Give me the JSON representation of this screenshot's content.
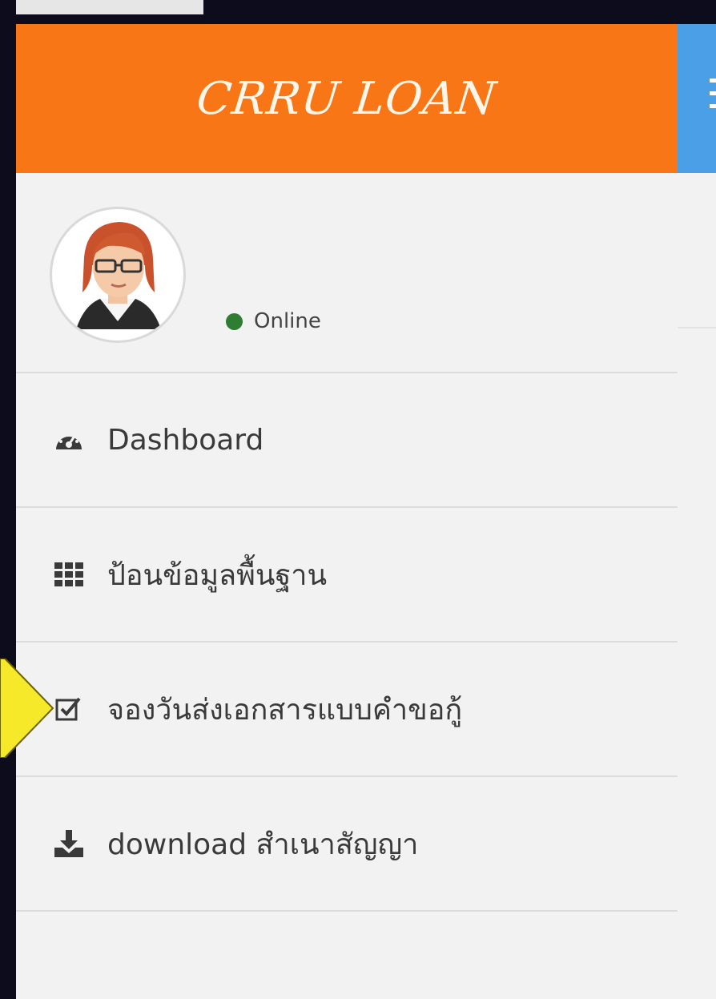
{
  "brand": {
    "title": "CRRU LOAN"
  },
  "user": {
    "status_text": "Online",
    "status_color": "#2e7d32"
  },
  "menu": {
    "items": [
      {
        "label": "Dashboard",
        "icon": "dashboard-icon"
      },
      {
        "label": "ป้อนข้อมูลพื้นฐาน",
        "icon": "grid-icon"
      },
      {
        "label": "จองวันส่งเอกสารแบบคำขอกู้",
        "icon": "checkbox-icon"
      },
      {
        "label": "download สำเนาสัญญา",
        "icon": "download-icon"
      }
    ]
  },
  "colors": {
    "brand": "#f97617",
    "header_blue": "#4a9fe6",
    "pointer": "#f5e92a"
  }
}
